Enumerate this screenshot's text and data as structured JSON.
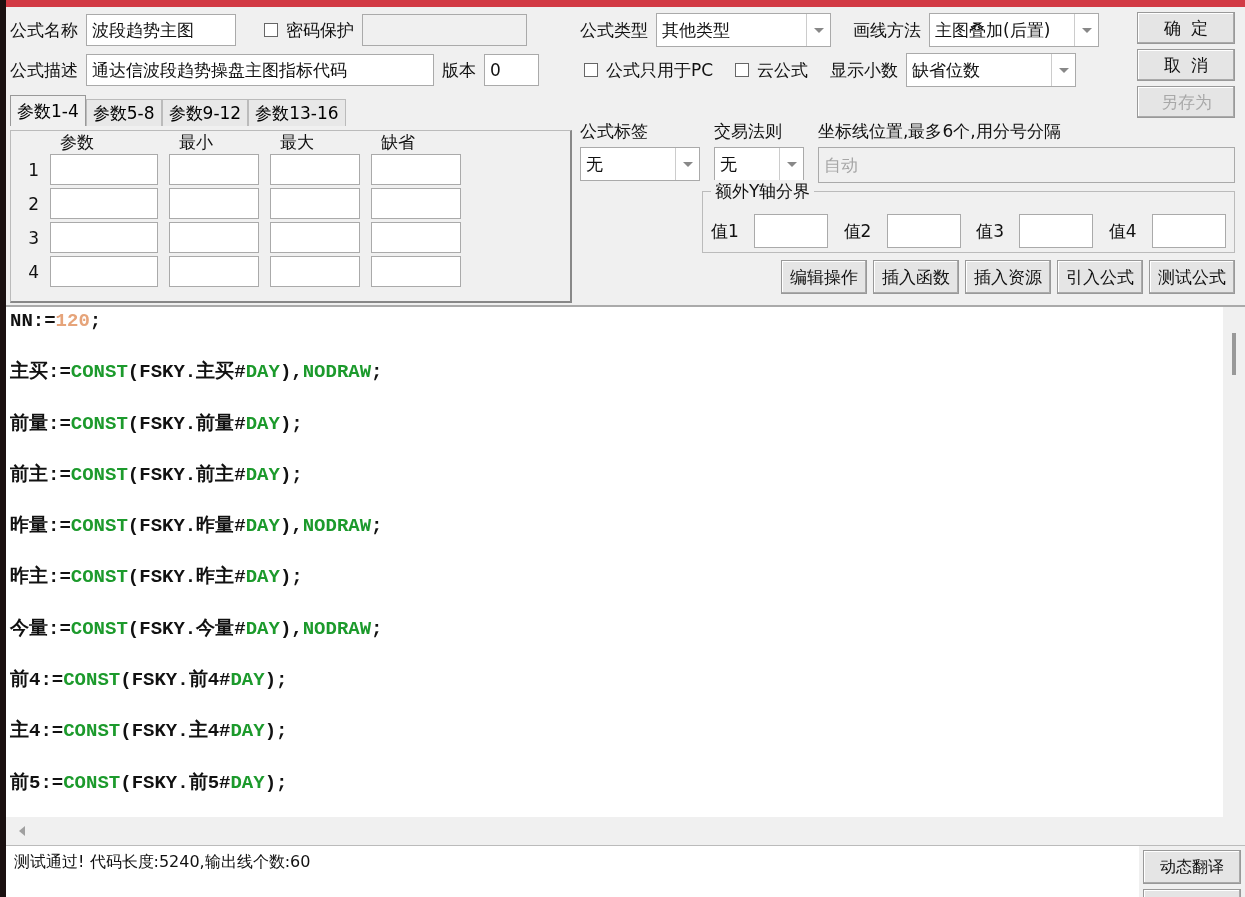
{
  "formula_name": {
    "label": "公式名称",
    "value": "波段趋势主图"
  },
  "password": {
    "label": "密码保护",
    "checked": false
  },
  "description": {
    "label": "公式描述",
    "value": "通达信波段趋势操盘主图指标代码"
  },
  "version": {
    "label": "版本",
    "value": "0"
  },
  "param_tabs": [
    {
      "label": "参数1-4",
      "selected": true
    },
    {
      "label": "参数5-8",
      "selected": false
    },
    {
      "label": "参数9-12",
      "selected": false
    },
    {
      "label": "参数13-16",
      "selected": false
    }
  ],
  "param_columns": [
    "参数",
    "最小",
    "最大",
    "缺省"
  ],
  "param_rows": [
    "1",
    "2",
    "3",
    "4"
  ],
  "formula_type": {
    "label": "公式类型",
    "value": "其他类型"
  },
  "draw_method": {
    "label": "画线方法",
    "value": "主图叠加(后置)"
  },
  "pc_only": {
    "label": "公式只用于PC",
    "checked": false
  },
  "cloud": {
    "label": "云公式",
    "checked": false
  },
  "decimals": {
    "label": "显示小数",
    "value": "缺省位数"
  },
  "side_buttons": [
    {
      "label": "确  定",
      "disabled": false
    },
    {
      "label": "取  消",
      "disabled": false
    },
    {
      "label": "另存为",
      "disabled": true
    }
  ],
  "tag": {
    "label": "公式标签",
    "value": "无"
  },
  "trade_rule": {
    "label": "交易法则",
    "value": "无"
  },
  "axis_lines": {
    "label": "坐标线位置,最多6个,用分号分隔",
    "placeholder": "自动"
  },
  "y_axis": {
    "title": "额外Y轴分界",
    "fields": [
      "值1",
      "值2",
      "值3",
      "值4"
    ]
  },
  "action_buttons": [
    "编辑操作",
    "插入函数",
    "插入资源",
    "引入公式",
    "测试公式"
  ],
  "code_lines": [
    [
      {
        "text": "NN:=",
        "kind": "plain"
      },
      {
        "text": "120",
        "kind": "number"
      },
      {
        "text": ";",
        "kind": "plain"
      }
    ],
    [
      {
        "text": "主买:=",
        "kind": "plain"
      },
      {
        "text": "CONST",
        "kind": "func"
      },
      {
        "text": "(FSKY.主买#",
        "kind": "plain"
      },
      {
        "text": "DAY",
        "kind": "func"
      },
      {
        "text": "),",
        "kind": "plain"
      },
      {
        "text": "NODRAW",
        "kind": "func"
      },
      {
        "text": ";",
        "kind": "plain"
      }
    ],
    [
      {
        "text": "前量:=",
        "kind": "plain"
      },
      {
        "text": "CONST",
        "kind": "func"
      },
      {
        "text": "(FSKY.前量#",
        "kind": "plain"
      },
      {
        "text": "DAY",
        "kind": "func"
      },
      {
        "text": ");",
        "kind": "plain"
      }
    ],
    [
      {
        "text": "前主:=",
        "kind": "plain"
      },
      {
        "text": "CONST",
        "kind": "func"
      },
      {
        "text": "(FSKY.前主#",
        "kind": "plain"
      },
      {
        "text": "DAY",
        "kind": "func"
      },
      {
        "text": ");",
        "kind": "plain"
      }
    ],
    [
      {
        "text": "昨量:=",
        "kind": "plain"
      },
      {
        "text": "CONST",
        "kind": "func"
      },
      {
        "text": "(FSKY.昨量#",
        "kind": "plain"
      },
      {
        "text": "DAY",
        "kind": "func"
      },
      {
        "text": "),",
        "kind": "plain"
      },
      {
        "text": "NODRAW",
        "kind": "func"
      },
      {
        "text": ";",
        "kind": "plain"
      }
    ],
    [
      {
        "text": "昨主:=",
        "kind": "plain"
      },
      {
        "text": "CONST",
        "kind": "func"
      },
      {
        "text": "(FSKY.昨主#",
        "kind": "plain"
      },
      {
        "text": "DAY",
        "kind": "func"
      },
      {
        "text": ");",
        "kind": "plain"
      }
    ],
    [
      {
        "text": "今量:=",
        "kind": "plain"
      },
      {
        "text": "CONST",
        "kind": "func"
      },
      {
        "text": "(FSKY.今量#",
        "kind": "plain"
      },
      {
        "text": "DAY",
        "kind": "func"
      },
      {
        "text": "),",
        "kind": "plain"
      },
      {
        "text": "NODRAW",
        "kind": "func"
      },
      {
        "text": ";",
        "kind": "plain"
      }
    ],
    [
      {
        "text": "前4:=",
        "kind": "plain"
      },
      {
        "text": "CONST",
        "kind": "func"
      },
      {
        "text": "(FSKY.前4#",
        "kind": "plain"
      },
      {
        "text": "DAY",
        "kind": "func"
      },
      {
        "text": ");",
        "kind": "plain"
      }
    ],
    [
      {
        "text": "主4:=",
        "kind": "plain"
      },
      {
        "text": "CONST",
        "kind": "func"
      },
      {
        "text": "(FSKY.主4#",
        "kind": "plain"
      },
      {
        "text": "DAY",
        "kind": "func"
      },
      {
        "text": ");",
        "kind": "plain"
      }
    ],
    [
      {
        "text": "前5:=",
        "kind": "plain"
      },
      {
        "text": "CONST",
        "kind": "func"
      },
      {
        "text": "(FSKY.前5#",
        "kind": "plain"
      },
      {
        "text": "DAY",
        "kind": "func"
      },
      {
        "text": ");",
        "kind": "plain"
      }
    ]
  ],
  "status": "测试通过! 代码长度:5240,输出线个数:60",
  "translate_button": "动态翻译"
}
